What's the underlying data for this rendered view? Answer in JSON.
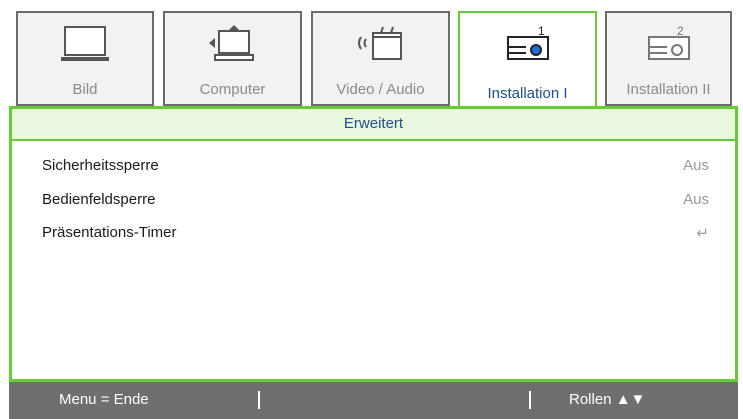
{
  "tabs": [
    {
      "label": "Bild",
      "icon": "monitor-icon"
    },
    {
      "label": "Computer",
      "icon": "computer-icon"
    },
    {
      "label": "Video / Audio",
      "icon": "video-audio-icon"
    },
    {
      "label": "Installation I",
      "icon": "projector-icon",
      "active": true
    },
    {
      "label": "Installation II",
      "icon": "projector-icon"
    }
  ],
  "panel": {
    "title": "Erweitert",
    "rows": [
      {
        "label": "Sicherheitssperre",
        "value": "Aus"
      },
      {
        "label": "Bedienfeldsperre",
        "value": "Aus"
      },
      {
        "label": "Präsentations-Timer",
        "value": "↵"
      }
    ]
  },
  "footer": {
    "left": "Menu = Ende",
    "right": "Rollen ▲▼"
  },
  "colors": {
    "accent_green": "#66cc33",
    "active_label": "#1f4f8f",
    "footer_bg": "#6f6f6f"
  }
}
